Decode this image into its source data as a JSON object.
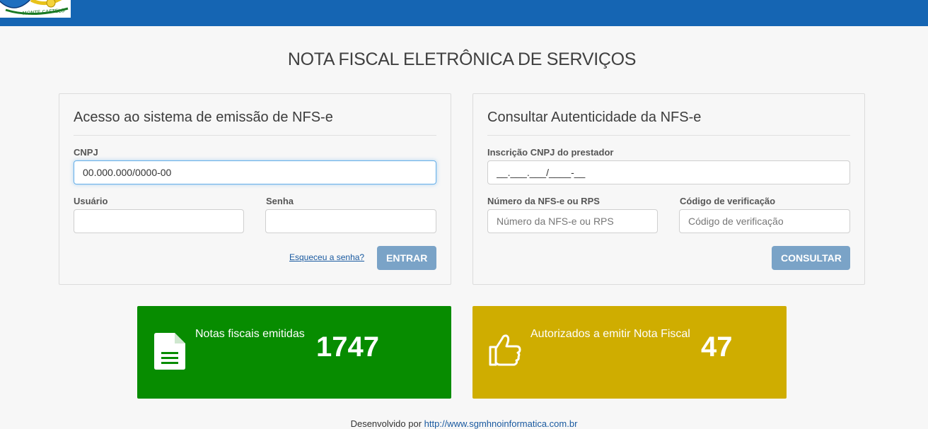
{
  "header": {
    "logo_icon": "municipal-crest-logo",
    "logo_text": "MONTE CASTELO",
    "bar_color": "#1565b3"
  },
  "page": {
    "title": "NOTA FISCAL ELETRÔNICA DE SERVIÇOS"
  },
  "login": {
    "heading": "Acesso ao sistema de emissão de NFS-e",
    "cnpj_label": "CNPJ",
    "cnpj_value": "00.000.000/0000-00",
    "user_label": "Usuário",
    "user_value": "",
    "password_label": "Senha",
    "password_value": "",
    "forgot_link": "Esqueceu a senha?",
    "submit_label": "ENTRAR"
  },
  "consult": {
    "heading": "Consultar Autenticidade da NFS-e",
    "cnpj_label": "Inscrição CNPJ do prestador",
    "cnpj_value": "__.___.___/____-__",
    "number_label": "Número da NFS-e ou RPS",
    "number_placeholder": "Número da NFS-e ou RPS",
    "code_label": "Código de verificação",
    "code_placeholder": "Código de verificação",
    "submit_label": "CONSULTAR"
  },
  "stats": [
    {
      "label": "Notas fiscais emitidas",
      "value": "1747",
      "icon": "document-icon",
      "color": "#078c00"
    },
    {
      "label": "Autorizados a emitir Nota Fiscal",
      "value": "47",
      "icon": "thumbs-up-icon",
      "color": "#cfad00"
    }
  ],
  "footer": {
    "text": "Desenvolvido por",
    "link": "http://www.sgmhnoinformatica.com.br"
  }
}
